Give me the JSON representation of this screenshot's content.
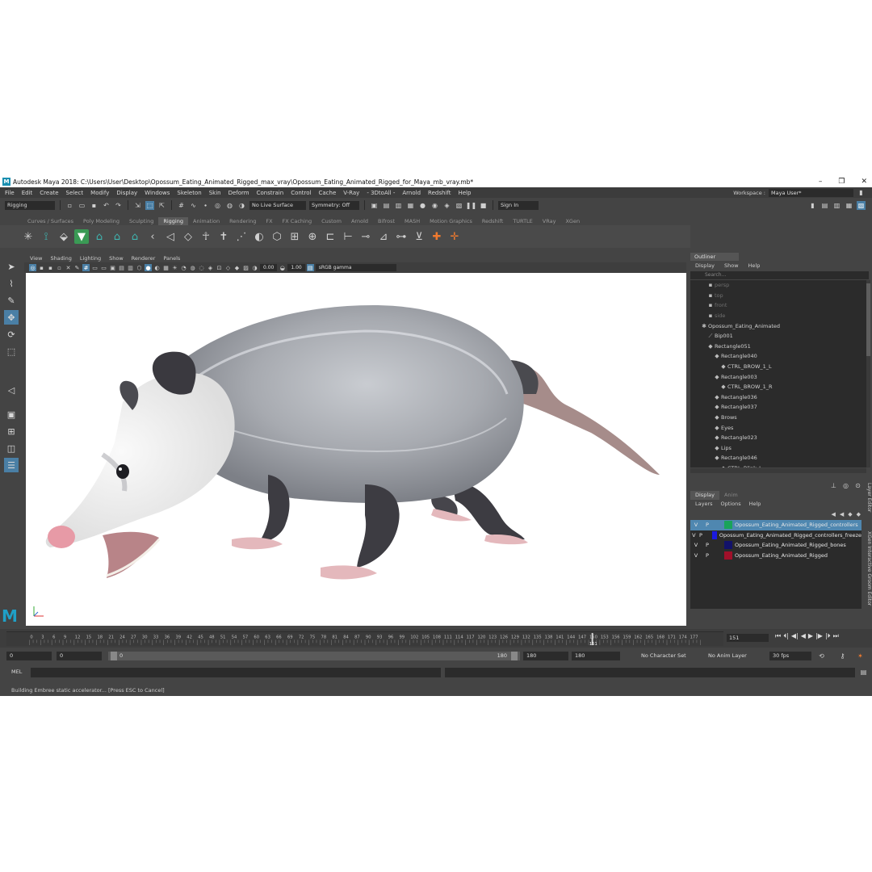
{
  "window": {
    "title": "Autodesk Maya 2018: C:\\Users\\User\\Desktop\\Opossum_Eating_Animated_Rigged_max_vray\\Opossum_Eating_Animated_Rigged_for_Maya_mb_vray.mb*",
    "logo": "M"
  },
  "menu": [
    "File",
    "Edit",
    "Create",
    "Select",
    "Modify",
    "Display",
    "Windows",
    "Skeleton",
    "Skin",
    "Deform",
    "Constrain",
    "Control",
    "Cache",
    "V-Ray",
    "- 3DtoAll -",
    "Arnold",
    "Redshift",
    "Help"
  ],
  "workspace": {
    "label": "Workspace :",
    "value": "Maya User*"
  },
  "status_line": {
    "mode": "Rigging",
    "live_surface": "No Live Surface",
    "symmetry": "Symmetry: Off",
    "sign_in": "Sign In"
  },
  "shelf_tabs": [
    "Curves / Surfaces",
    "Poly Modeling",
    "Sculpting",
    "Rigging",
    "Animation",
    "Rendering",
    "FX",
    "FX Caching",
    "Custom",
    "Arnold",
    "Bifrost",
    "MASH",
    "Motion Graphics",
    "Redshift",
    "TURTLE",
    "VRay",
    "XGen"
  ],
  "shelf_active": "Rigging",
  "viewport": {
    "menu": [
      "View",
      "Shading",
      "Lighting",
      "Show",
      "Renderer",
      "Panels"
    ],
    "exposure": "0.00",
    "gamma": "1.00",
    "color_space": "sRGB gamma"
  },
  "outliner": {
    "title": "Outliner",
    "menu": [
      "Display",
      "Show",
      "Help"
    ],
    "search_placeholder": "Search...",
    "rows": [
      {
        "label": "persp",
        "dim": true,
        "glyph": "▪",
        "indent": 20
      },
      {
        "label": "top",
        "dim": true,
        "glyph": "▪",
        "indent": 20
      },
      {
        "label": "front",
        "dim": true,
        "glyph": "▪",
        "indent": 20
      },
      {
        "label": "side",
        "dim": true,
        "glyph": "▪",
        "indent": 20
      },
      {
        "label": "Opossum_Eating_Animated",
        "dim": false,
        "glyph": "✱",
        "indent": 12
      },
      {
        "label": "Bip001",
        "dim": false,
        "glyph": "⟋",
        "indent": 20
      },
      {
        "label": "Rectangle051",
        "dim": false,
        "glyph": "◆",
        "indent": 20
      },
      {
        "label": "Rectangle040",
        "dim": false,
        "glyph": "◆",
        "indent": 28
      },
      {
        "label": "CTRL_BROW_1_L",
        "dim": false,
        "glyph": "◆",
        "indent": 36
      },
      {
        "label": "Rectangle003",
        "dim": false,
        "glyph": "◆",
        "indent": 28
      },
      {
        "label": "CTRL_BROW_1_R",
        "dim": false,
        "glyph": "◆",
        "indent": 36
      },
      {
        "label": "Rectangle036",
        "dim": false,
        "glyph": "◆",
        "indent": 28
      },
      {
        "label": "Rectangle037",
        "dim": false,
        "glyph": "◆",
        "indent": 28
      },
      {
        "label": "Brows",
        "dim": false,
        "glyph": "◆",
        "indent": 28
      },
      {
        "label": "Eyes",
        "dim": false,
        "glyph": "◆",
        "indent": 28
      },
      {
        "label": "Rectangle023",
        "dim": false,
        "glyph": "◆",
        "indent": 28
      },
      {
        "label": "Lips",
        "dim": false,
        "glyph": "◆",
        "indent": 28
      },
      {
        "label": "Rectangle046",
        "dim": false,
        "glyph": "◆",
        "indent": 28
      },
      {
        "label": "CTRL_Blink_L",
        "dim": false,
        "glyph": "◆",
        "indent": 36
      }
    ]
  },
  "layer_editor": {
    "tabs": [
      "Display",
      "Anim"
    ],
    "menu": [
      "Layers",
      "Options",
      "Help"
    ],
    "layers": [
      {
        "v": "V",
        "p": "P",
        "color": "#19a35a",
        "name": "Opossum_Eating_Animated_Rigged_controllers",
        "selected": true
      },
      {
        "v": "V",
        "p": "P",
        "color": "#1a1ae0",
        "name": "Opossum_Eating_Animated_Rigged_controllers_freeze",
        "selected": false
      },
      {
        "v": "V",
        "p": "P",
        "color": "#12126a",
        "name": "Opossum_Eating_Animated_Rigged_bones",
        "selected": false
      },
      {
        "v": "V",
        "p": "P",
        "color": "#a0102a",
        "name": "Opossum_Eating_Animated_Rigged",
        "selected": false
      }
    ]
  },
  "side_tabs": [
    "Layer Editor",
    "XGen Interactive Groom Editor"
  ],
  "timeline": {
    "ticks": [
      "0",
      "3",
      "6",
      "9",
      "12",
      "15",
      "18",
      "21",
      "24",
      "27",
      "30",
      "33",
      "36",
      "39",
      "42",
      "45",
      "48",
      "51",
      "54",
      "57",
      "60",
      "63",
      "66",
      "69",
      "72",
      "75",
      "78",
      "81",
      "84",
      "87",
      "90",
      "93",
      "96",
      "99",
      "102",
      "105",
      "108",
      "111",
      "114",
      "117",
      "120",
      "123",
      "126",
      "129",
      "132",
      "135",
      "138",
      "141",
      "144",
      "147",
      "150",
      "153",
      "156",
      "159",
      "162",
      "165",
      "168",
      "171",
      "174",
      "177"
    ],
    "current_frame": "151",
    "marker": "151",
    "max_frame": 180
  },
  "range": {
    "start": "0",
    "playback_start": "0",
    "slider_start": "0",
    "slider_end": "180",
    "playback_end": "180",
    "end": "180",
    "character_set": "No Character Set",
    "anim_layer": "No Anim Layer",
    "fps": "30 fps"
  },
  "command_line": {
    "label": "MEL"
  },
  "status_message": "Building Embree static accelerator... [Press ESC to Cancel]"
}
